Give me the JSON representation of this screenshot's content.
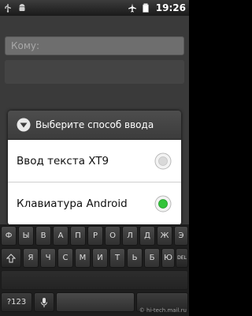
{
  "status_bar": {
    "time": "19:26",
    "icons": [
      "usb-icon",
      "android-icon",
      "airplane-mode-icon",
      "battery-icon"
    ]
  },
  "compose": {
    "to_placeholder": "Кому:"
  },
  "dialog": {
    "title": "Выберите способ ввода",
    "options": [
      {
        "label": "Ввод текста XT9",
        "selected": false
      },
      {
        "label": "Клавиатура Android",
        "selected": true
      }
    ]
  },
  "keyboard": {
    "rows": [
      [
        "Ф",
        "Ы",
        "В",
        "А",
        "П",
        "Р",
        "О",
        "Л",
        "Д",
        "Ж",
        "Э"
      ],
      [
        "Я",
        "Ч",
        "С",
        "М",
        "И",
        "Т",
        "Ь",
        "Б",
        "Ю",
        "DEL"
      ]
    ],
    "mode_key": "?123"
  },
  "watermark": "© hi-tech.mail.ru"
}
